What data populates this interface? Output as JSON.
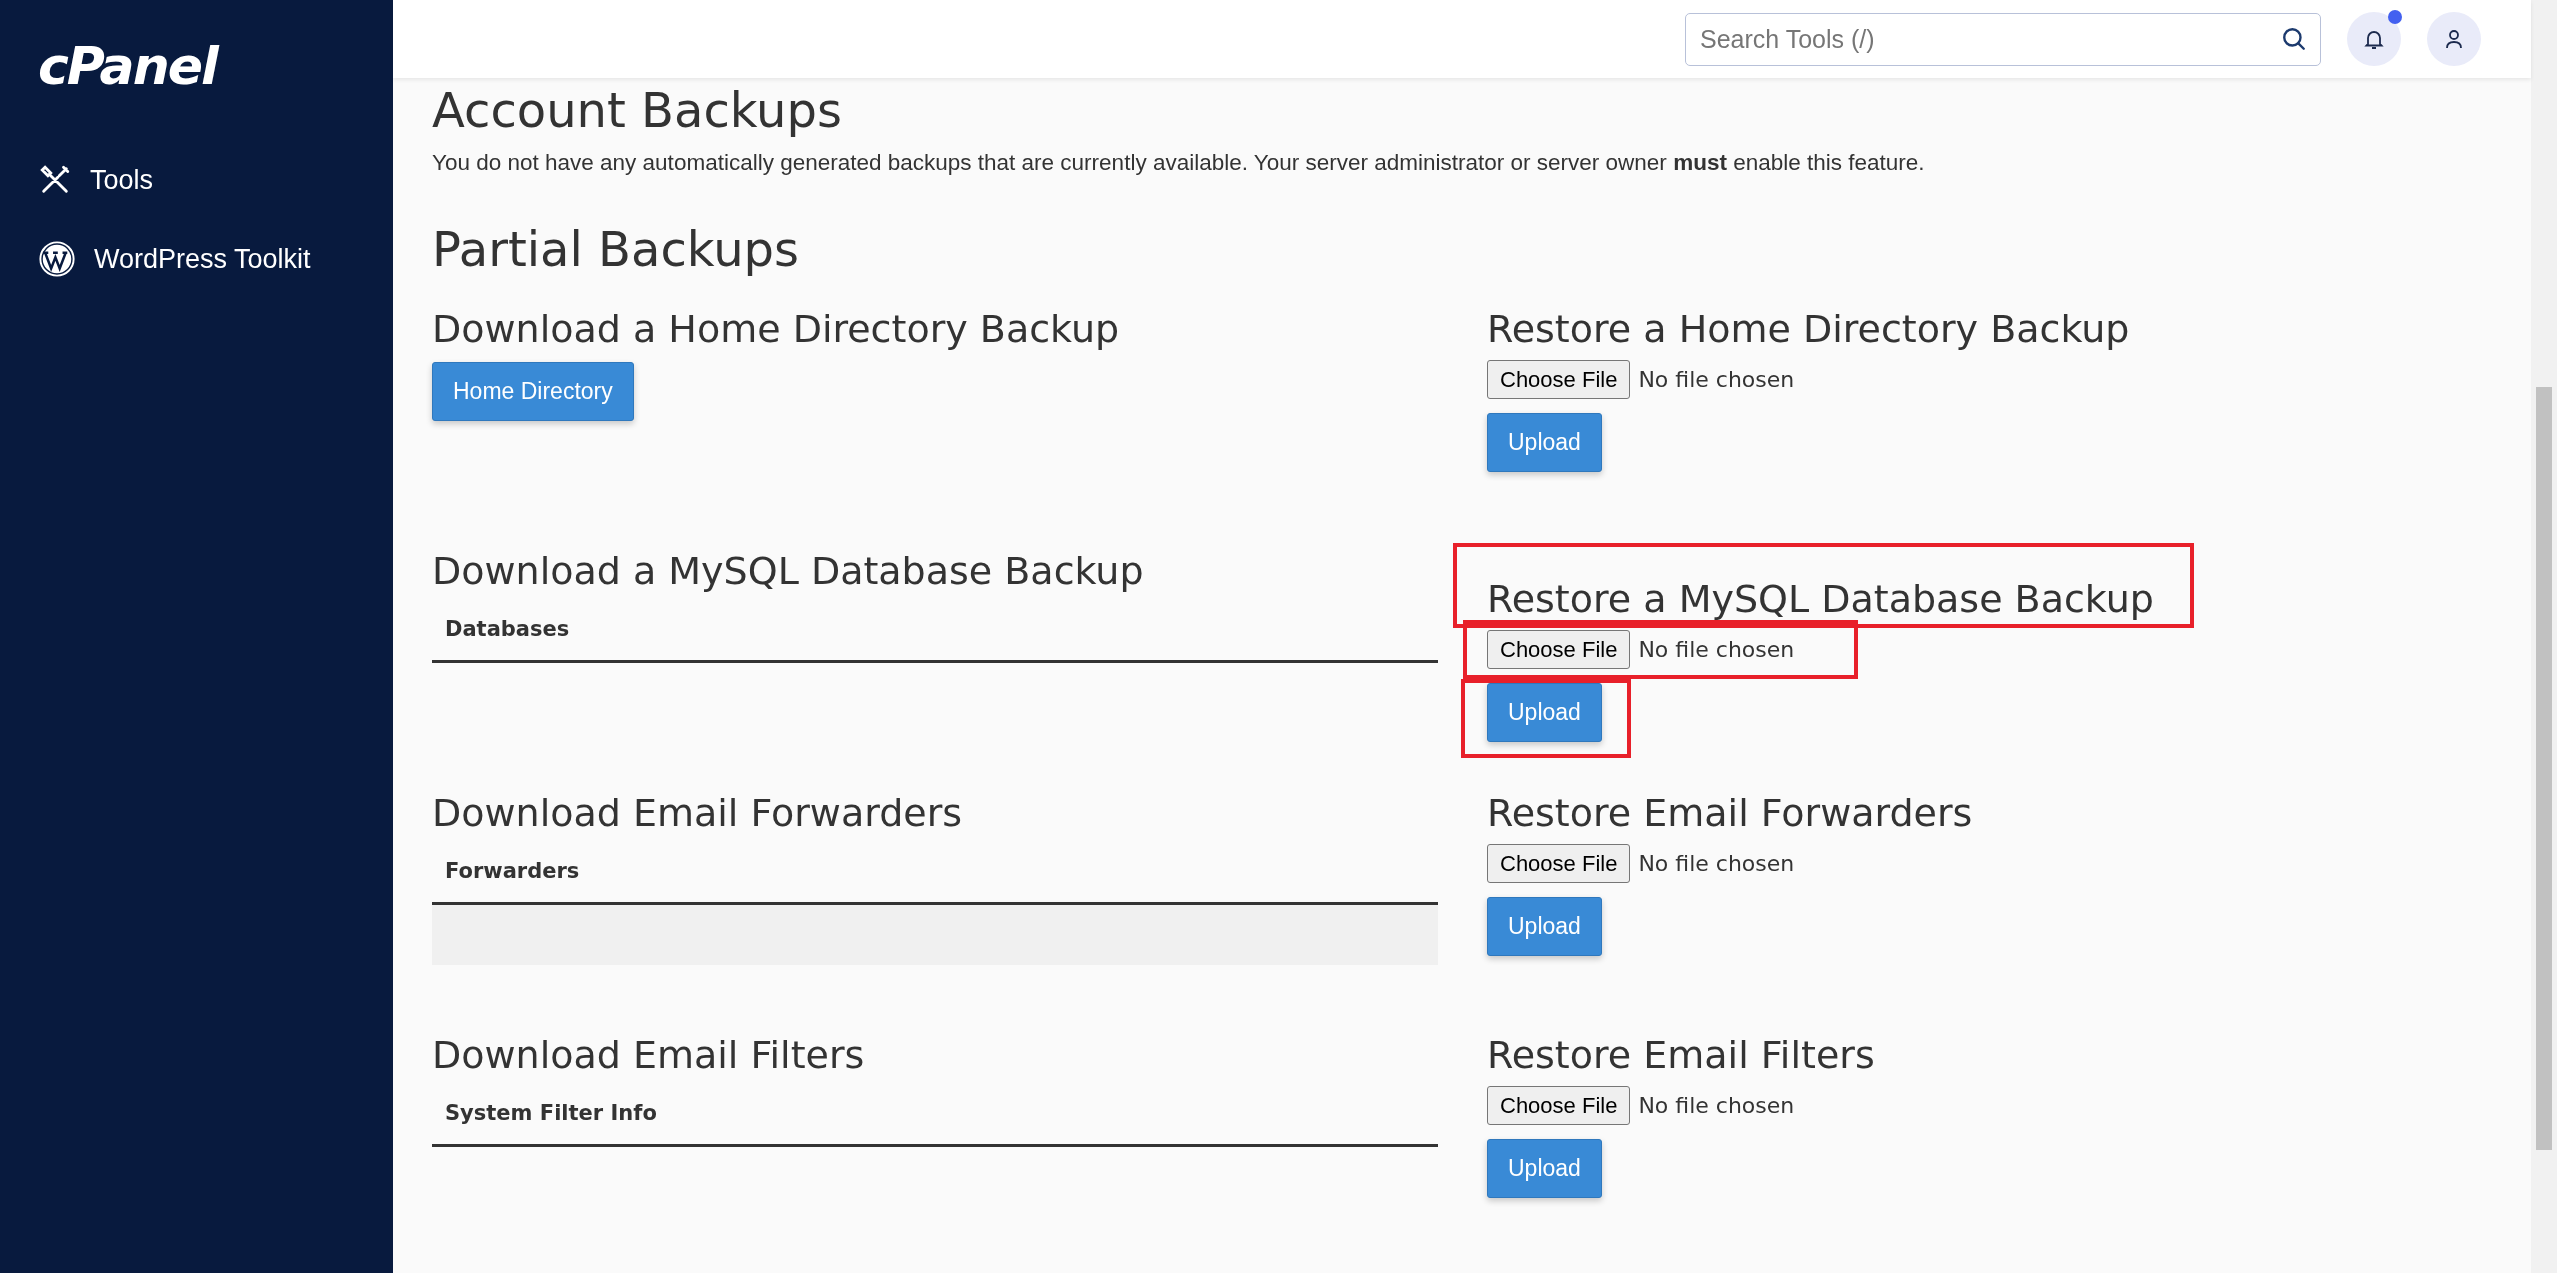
{
  "sidebar": {
    "logo": "cPanel",
    "items": [
      {
        "label": "Tools"
      },
      {
        "label": "WordPress Toolkit"
      }
    ]
  },
  "header": {
    "search": {
      "placeholder": "Search Tools (/)"
    },
    "notifications": {
      "unread": true
    }
  },
  "account_backups": {
    "title": "Account Backups",
    "message": "You do not have any automatically generated backups that are currently available. Your server administrator or server owner **must** enable this feature."
  },
  "partial_backups": {
    "title": "Partial Backups",
    "rows": [
      {
        "download": {
          "title": "Download a Home Directory Backup",
          "kind": "button",
          "button": "Home Directory"
        },
        "restore": {
          "title": "Restore a Home Directory Backup",
          "file_button": "Choose File",
          "file_status": "No file chosen",
          "upload": "Upload",
          "highlighted": false
        }
      },
      {
        "download": {
          "title": "Download a MySQL Database Backup",
          "kind": "table",
          "column": "Databases",
          "empty_row": false
        },
        "restore": {
          "title": "Restore a MySQL Database Backup",
          "file_button": "Choose File",
          "file_status": "No file chosen",
          "upload": "Upload",
          "highlighted": true
        }
      },
      {
        "download": {
          "title": "Download Email Forwarders",
          "kind": "table",
          "column": "Forwarders",
          "empty_row": true
        },
        "restore": {
          "title": "Restore Email Forwarders",
          "file_button": "Choose File",
          "file_status": "No file chosen",
          "upload": "Upload",
          "highlighted": false
        }
      },
      {
        "download": {
          "title": "Download Email Filters",
          "kind": "table",
          "column": "System Filter Info",
          "empty_row": false
        },
        "restore": {
          "title": "Restore Email Filters",
          "file_button": "Choose File",
          "file_status": "No file chosen",
          "upload": "Upload",
          "highlighted": false
        }
      }
    ]
  }
}
